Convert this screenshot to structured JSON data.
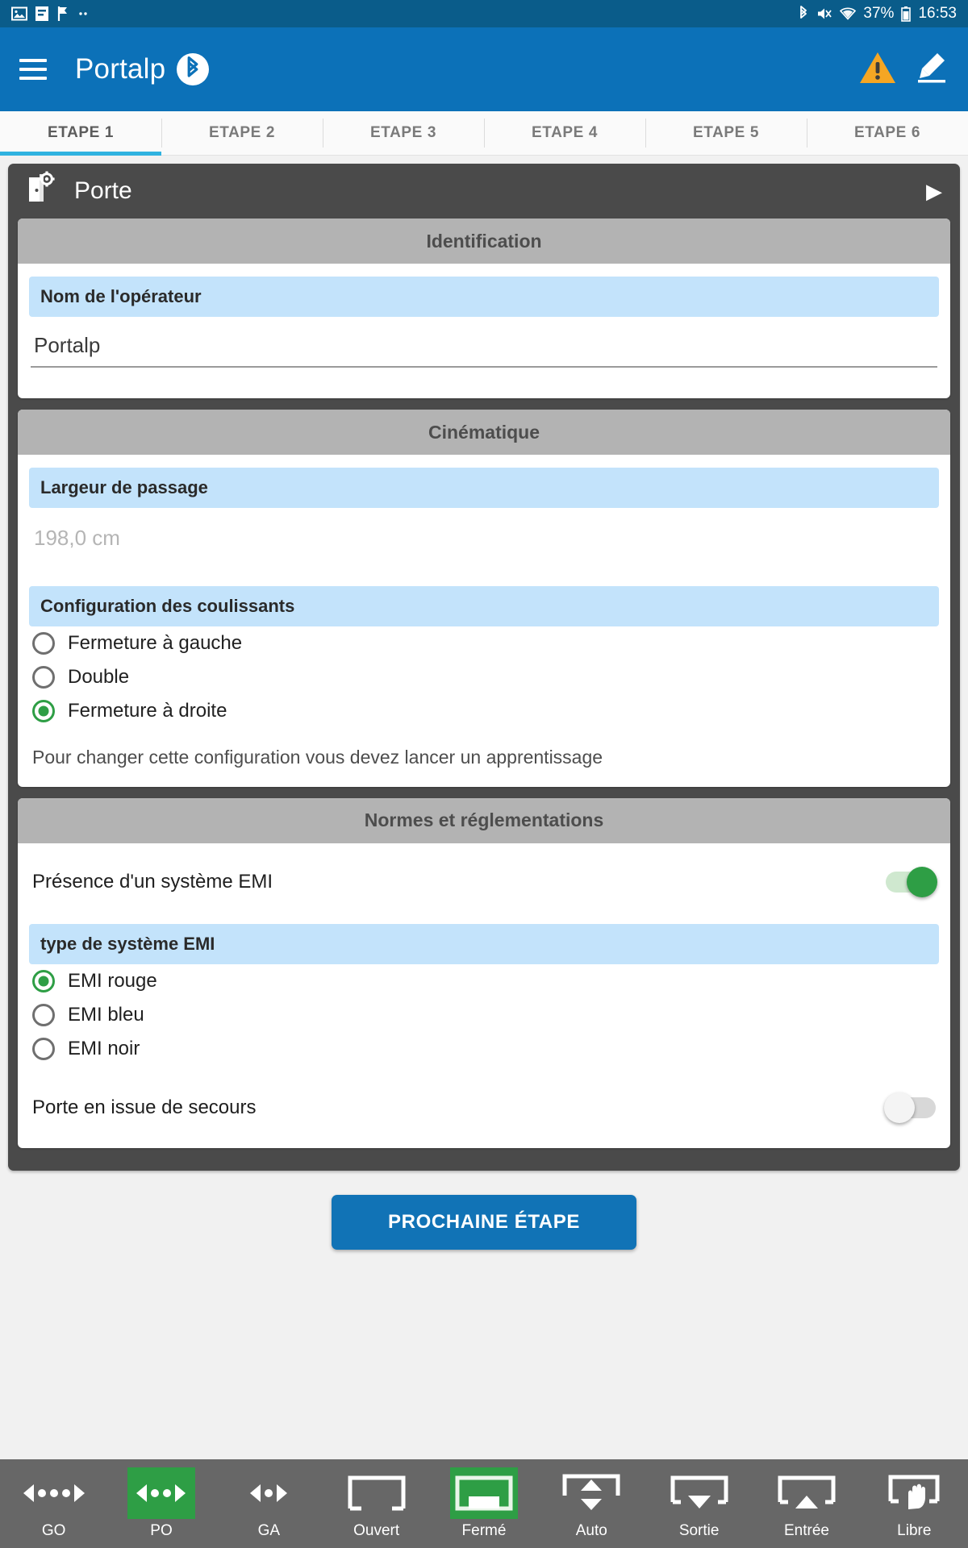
{
  "statusbar": {
    "left_icons": [
      "image-icon",
      "file-icon",
      "flag-icon",
      "more-icon"
    ],
    "bluetooth_icon": "bluetooth-icon",
    "mute_icon": "volume-muted-icon",
    "wifi_icon": "wifi-icon",
    "battery_percent": "37%",
    "battery_icon": "battery-icon",
    "clock": "16:53"
  },
  "appbar": {
    "menu_icon": "hamburger-menu-icon",
    "title": "Portalp",
    "bluetooth_badge_icon": "bluetooth-icon",
    "warning_icon": "warning-triangle-icon",
    "edit_icon": "pencil-edit-icon"
  },
  "tabs": [
    {
      "label": "ETAPE 1",
      "active": true
    },
    {
      "label": "ETAPE 2",
      "active": false
    },
    {
      "label": "ETAPE 3",
      "active": false
    },
    {
      "label": "ETAPE 4",
      "active": false
    },
    {
      "label": "ETAPE 5",
      "active": false
    },
    {
      "label": "ETAPE 6",
      "active": false
    }
  ],
  "card": {
    "icon": "door-settings-icon",
    "title": "Porte",
    "expand_caret": "caret-right-icon"
  },
  "identification": {
    "header": "Identification",
    "operator_label": "Nom de l'opérateur",
    "operator_value": "Portalp"
  },
  "cinematique": {
    "header": "Cinématique",
    "width_label": "Largeur de passage",
    "width_placeholder": "198,0 cm",
    "config_label": "Configuration des coulissants",
    "config_options": [
      {
        "label": "Fermeture à gauche",
        "selected": false
      },
      {
        "label": "Double",
        "selected": false
      },
      {
        "label": "Fermeture à droite",
        "selected": true
      }
    ],
    "hint": "Pour changer cette configuration vous devez lancer un apprentissage"
  },
  "normes": {
    "header": "Normes et réglementations",
    "emi_presence_label": "Présence d'un système EMI",
    "emi_presence_on": true,
    "emi_type_label": "type de système EMI",
    "emi_type_options": [
      {
        "label": "EMI rouge",
        "selected": true
      },
      {
        "label": "EMI bleu",
        "selected": false
      },
      {
        "label": "EMI noir",
        "selected": false
      }
    ],
    "emergency_exit_label": "Porte en issue de secours",
    "emergency_exit_on": false
  },
  "cta": {
    "label": "PROCHAINE ÉTAPE"
  },
  "bottombar": [
    {
      "label": "GO",
      "icon": "arrows-wide-icon",
      "active": false
    },
    {
      "label": "PO",
      "icon": "arrows-medium-icon",
      "active": true
    },
    {
      "label": "GA",
      "icon": "arrows-narrow-icon",
      "active": false
    },
    {
      "label": "Ouvert",
      "icon": "door-open-icon",
      "active": false
    },
    {
      "label": "Fermé",
      "icon": "door-closed-icon",
      "active": true
    },
    {
      "label": "Auto",
      "icon": "door-auto-icon",
      "active": false
    },
    {
      "label": "Sortie",
      "icon": "door-exit-icon",
      "active": false
    },
    {
      "label": "Entrée",
      "icon": "door-entry-icon",
      "active": false
    },
    {
      "label": "Libre",
      "icon": "door-free-hand-icon",
      "active": false
    }
  ],
  "colors": {
    "appbar_blue": "#0c71b8",
    "statusbar_blue": "#0a5c8a",
    "accent_cyan": "#2fb2e0",
    "green": "#2e9e45",
    "warning_orange": "#f5a623",
    "light_blue_bar": "#c3e3fb",
    "panel_header_gray": "#b3b3b3",
    "dark_card_gray": "#4a4a4a",
    "bottombar_gray": "#676767"
  }
}
